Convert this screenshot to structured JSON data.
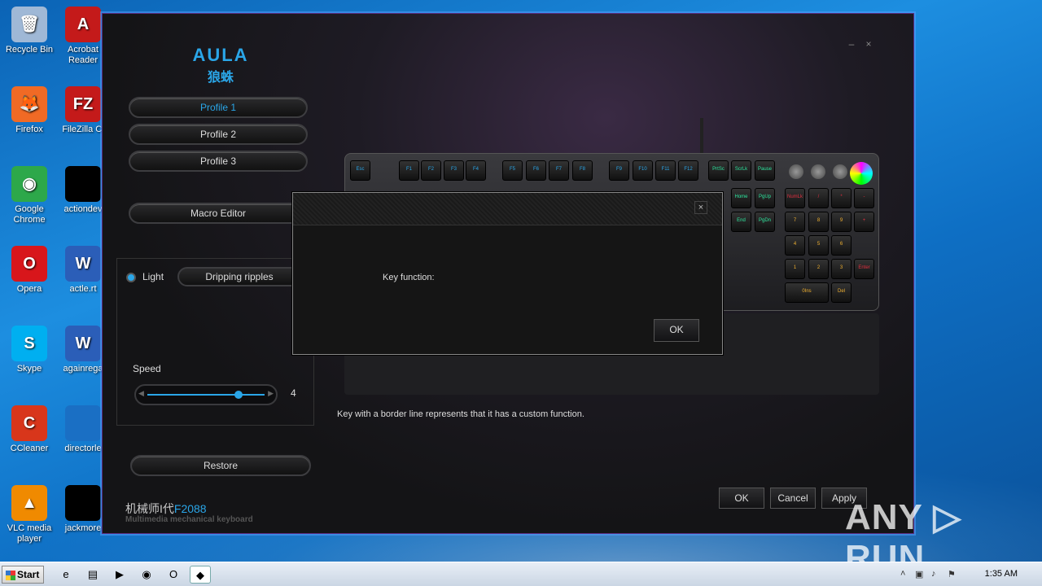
{
  "desktop": {
    "icons": [
      {
        "label": "Recycle Bin",
        "icon": "recycle-bin-icon",
        "glyph": "🗑",
        "color": "#9fb8d6"
      },
      {
        "label": "Acrobat Reader",
        "icon": "acrobat-icon",
        "glyph": "A",
        "color": "#c41a1a"
      },
      {
        "label": "Firefox",
        "icon": "firefox-icon",
        "glyph": "🦊",
        "color": "#f06a25"
      },
      {
        "label": "FileZilla Cl",
        "icon": "filezilla-icon",
        "glyph": "FZ",
        "color": "#c41a1a"
      },
      {
        "label": "Google Chrome",
        "icon": "chrome-icon",
        "glyph": "◉",
        "color": "#2da84a"
      },
      {
        "label": "actiondev",
        "icon": "file-icon",
        "glyph": "",
        "color": "#000000"
      },
      {
        "label": "Opera",
        "icon": "opera-icon",
        "glyph": "O",
        "color": "#d8161b"
      },
      {
        "label": "actle.rt",
        "icon": "word-doc-icon",
        "glyph": "W",
        "color": "#2b5eb8"
      },
      {
        "label": "Skype",
        "icon": "skype-icon",
        "glyph": "S",
        "color": "#00aff0"
      },
      {
        "label": "againrega",
        "icon": "word-doc-icon",
        "glyph": "W",
        "color": "#2b5eb8"
      },
      {
        "label": "CCleaner",
        "icon": "ccleaner-icon",
        "glyph": "C",
        "color": "#d8361b"
      },
      {
        "label": "directorle",
        "icon": "file-icon",
        "glyph": "",
        "color": "#1a6fc4"
      },
      {
        "label": "VLC media player",
        "icon": "vlc-icon",
        "glyph": "▲",
        "color": "#f08a00"
      },
      {
        "label": "jackmore",
        "icon": "file-icon",
        "glyph": "",
        "color": "#000000"
      }
    ]
  },
  "app": {
    "logo": {
      "brand": "AULA",
      "cn": "狼蛛"
    },
    "window_controls": {
      "minimize": "–",
      "close": "×"
    },
    "profiles": [
      "Profile 1",
      "Profile 2",
      "Profile 3"
    ],
    "active_profile": "Profile 1",
    "macro_editor": "Macro Editor",
    "light": {
      "label": "Light",
      "effect": "Dripping ripples",
      "speed_label": "Speed",
      "speed_value": "4",
      "speed_fraction": 0.75
    },
    "restore": "Restore",
    "model": {
      "prefix": "机械师I代",
      "code": "F2088",
      "subtitle": "Multimedia mechanical keyboard"
    },
    "hint": "Key with a border line represents that it has a custom function.",
    "buttons": {
      "ok": "OK",
      "cancel": "Cancel",
      "apply": "Apply"
    },
    "keyboard": {
      "fn_row": [
        "Esc",
        "F1",
        "F2",
        "F3",
        "F4",
        "F5",
        "F6",
        "F7",
        "F8",
        "F9",
        "F10",
        "F11",
        "F12",
        "PrtSc",
        "ScrLk",
        "Pause"
      ],
      "nav": [
        "Home",
        "PgUp",
        "End",
        "PgDn"
      ],
      "numpad": [
        "NumLk",
        "/",
        "*",
        "-",
        "7",
        "8",
        "9",
        "+",
        "4",
        "5",
        "6",
        "1",
        "2",
        "3",
        "Enter",
        "0Ins",
        "Del"
      ]
    },
    "accent": "#2aa6e8"
  },
  "dialog": {
    "close": "×",
    "label": "Key function:",
    "ok": "OK"
  },
  "taskbar": {
    "start": "Start",
    "items": [
      {
        "icon": "ie-icon",
        "glyph": "e"
      },
      {
        "icon": "folder-icon",
        "glyph": "▤"
      },
      {
        "icon": "media-player-icon",
        "glyph": "▶"
      },
      {
        "icon": "chrome-icon",
        "glyph": "◉"
      },
      {
        "icon": "opera-icon",
        "glyph": "O"
      },
      {
        "icon": "aula-icon",
        "glyph": "◆"
      }
    ],
    "clock": "1:35 AM"
  },
  "watermark": "ANY ▷ RUN"
}
